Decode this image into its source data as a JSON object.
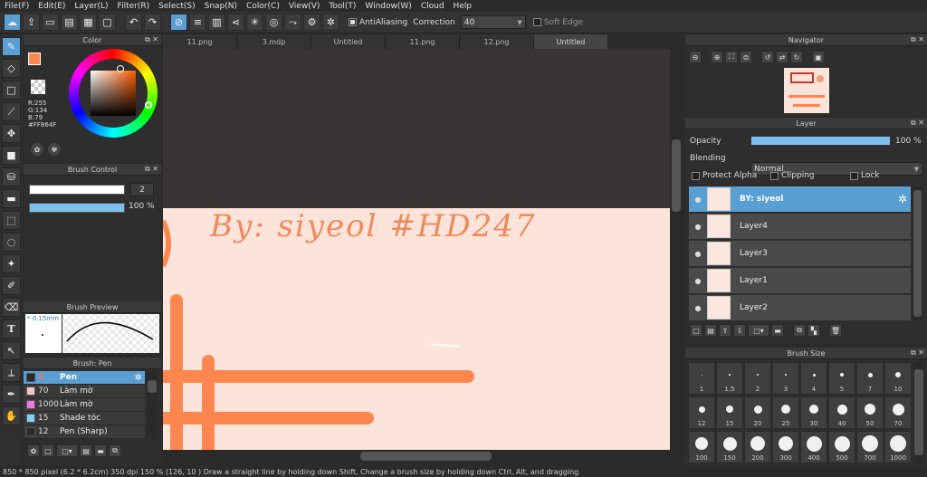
{
  "menu": [
    "File(F)",
    "Edit(E)",
    "Layer(L)",
    "Filter(R)",
    "Select(S)",
    "Snap(N)",
    "Color(C)",
    "View(V)",
    "Tool(T)",
    "Window(W)",
    "Cloud",
    "Help"
  ],
  "toolbar": {
    "antialiasing_label": "AntiAliasing",
    "correction_label": "Correction",
    "correction_value": "40",
    "soft_edge_label": "Soft Edge"
  },
  "color_panel": {
    "title": "Color",
    "r": "R:255",
    "g": "G:134",
    "b": "B:79",
    "hex": "#FF864F",
    "fg_color": "#ff864f"
  },
  "brush_control": {
    "title": "Brush Control",
    "size_value": "2",
    "opacity_value": "100 %"
  },
  "brush_preview": {
    "title": "Brush Preview",
    "size_label": "* 0.15mm"
  },
  "brush_list": {
    "title": "Brush: Pen",
    "items": [
      {
        "size": "2",
        "name": "Pen",
        "color": "#2a2a2a",
        "selected": true
      },
      {
        "size": "70",
        "name": "Làm mờ",
        "color": "#f4c6c6",
        "selected": false
      },
      {
        "size": "1000",
        "name": "Làm mờ",
        "color": "#f078e0",
        "selected": false
      },
      {
        "size": "15",
        "name": "Shade tóc",
        "color": "#7fd1f5",
        "selected": false
      },
      {
        "size": "12",
        "name": "Pen (Sharp)",
        "color": "#2a2a2a",
        "selected": false
      }
    ]
  },
  "tabs": [
    "11.png",
    "3.mdp",
    "Untitled",
    "11.png",
    "12.png",
    "Untitled"
  ],
  "canvas": {
    "signature_text": "By: siyeol #HD247",
    "paper_color": "#fde4da",
    "stroke_color": "#ff864f"
  },
  "navigator": {
    "title": "Navigator"
  },
  "layer_panel": {
    "title": "Layer",
    "opacity_label": "Opacity",
    "opacity_value": "100 %",
    "blending_label": "Blending",
    "blending_value": "Normal",
    "protect_alpha": "Protect Alpha",
    "clipping": "Clipping",
    "lock": "Lock",
    "layers": [
      {
        "name": "BY: siyeol",
        "selected": true
      },
      {
        "name": "Layer4",
        "selected": false
      },
      {
        "name": "Layer3",
        "selected": false
      },
      {
        "name": "Layer1",
        "selected": false
      },
      {
        "name": "Layer2",
        "selected": false
      }
    ]
  },
  "brush_size": {
    "title": "Brush Size",
    "sizes": [
      "1",
      "1.5",
      "2",
      "3",
      "4",
      "5",
      "7",
      "10",
      "12",
      "15",
      "20",
      "25",
      "30",
      "40",
      "50",
      "70",
      "100",
      "150",
      "200",
      "300",
      "400",
      "500",
      "700",
      "1000"
    ]
  },
  "status": {
    "text": "850 * 850 pixel   (6.2 * 6.2cm)   350 dpi   150 %   (126, 10 )   Draw a straight line by holding down Shift, Change a brush size by holding down Ctrl, Alt, and dragging"
  }
}
